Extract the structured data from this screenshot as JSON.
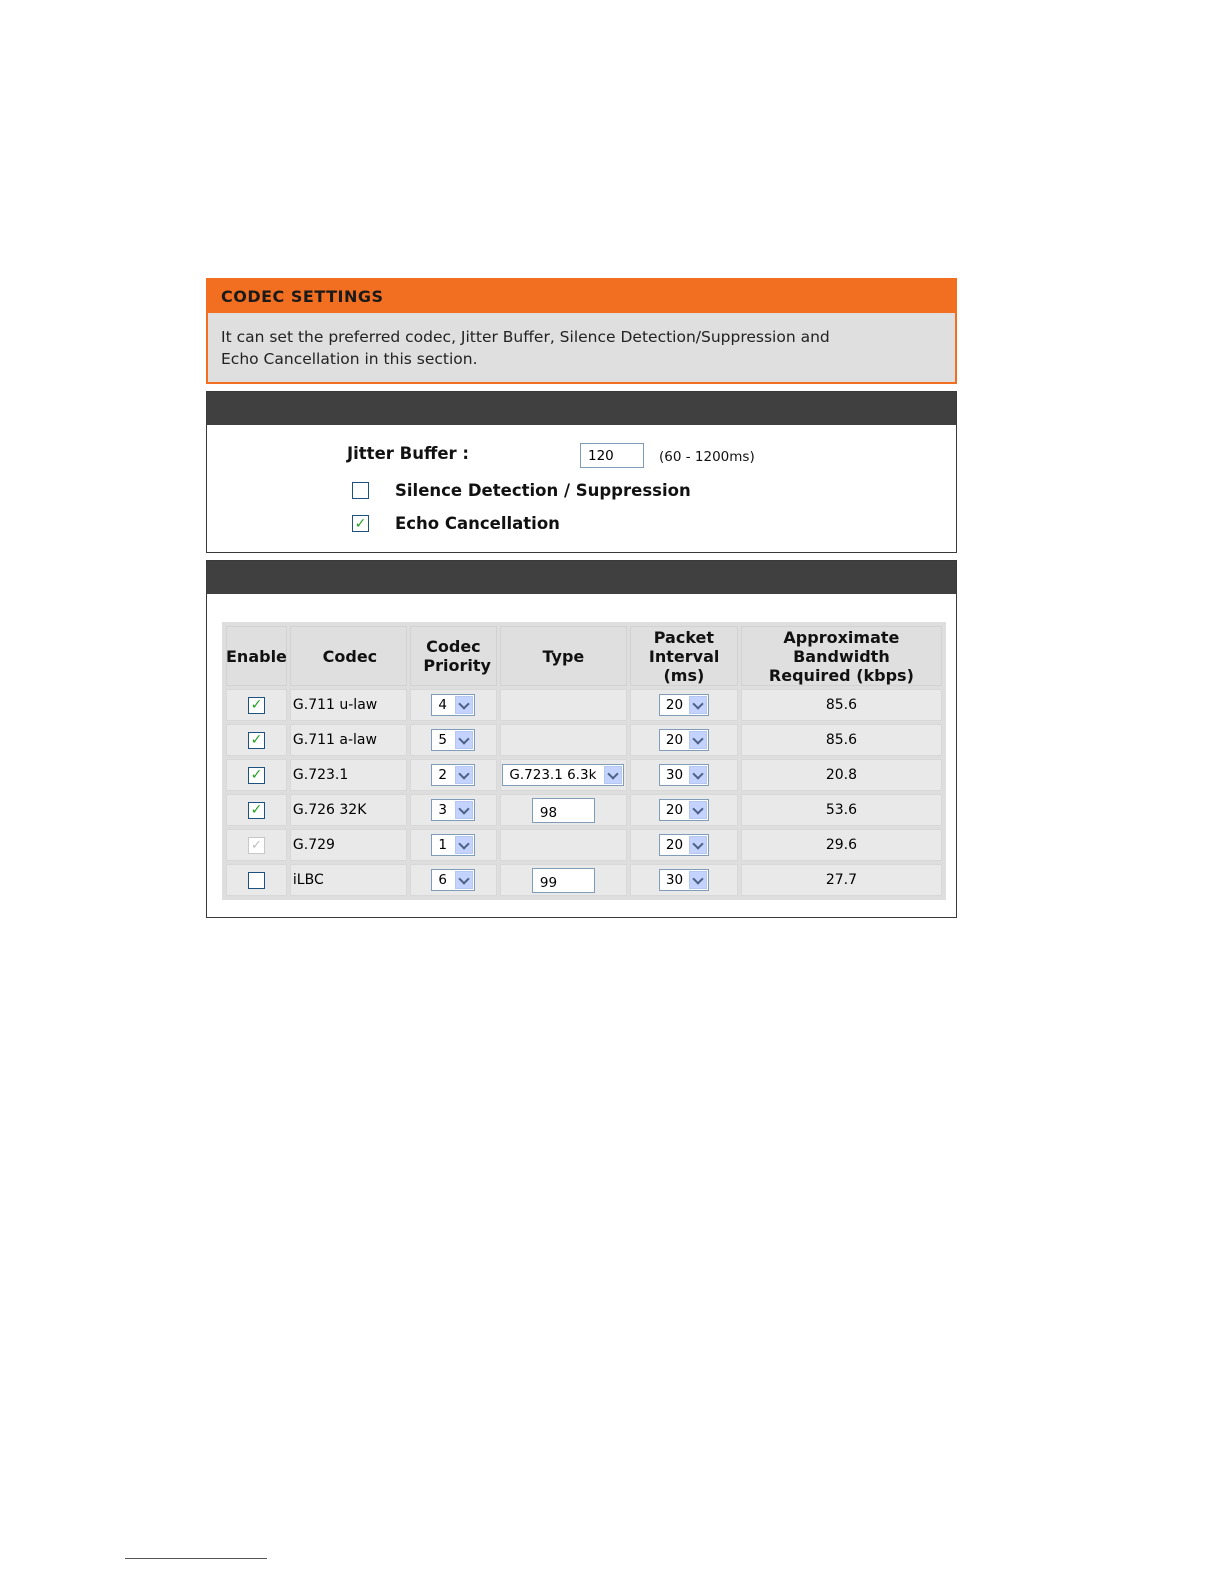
{
  "header": {
    "title": "CODEC SETTINGS",
    "description": "It can set the preferred codec, Jitter Buffer, Silence Detection/Suppression and Echo Cancellation in this section."
  },
  "voice_settings": {
    "jitter_label": "Jitter Buffer :",
    "jitter_value": "120",
    "jitter_range": "(60 - 1200ms)",
    "silence_label": "Silence Detection / Suppression",
    "silence_checked": false,
    "echo_label": "Echo Cancellation",
    "echo_checked": true
  },
  "codec_table": {
    "headers": {
      "enable": "Enable",
      "codec": "Codec",
      "priority": "Codec Priority",
      "type": "Type",
      "packet_interval": "Packet Interval (ms)",
      "bandwidth": "Approximate Bandwidth Required (kbps)"
    },
    "rows": [
      {
        "enabled": "checked",
        "codec": "G.711 u-law",
        "priority": "4",
        "type": "",
        "interval": "20",
        "bandwidth": "85.6"
      },
      {
        "enabled": "checked",
        "codec": "G.711 a-law",
        "priority": "5",
        "type": "",
        "interval": "20",
        "bandwidth": "85.6"
      },
      {
        "enabled": "checked",
        "codec": "G.723.1",
        "priority": "2",
        "type": "G.723.1 6.3k",
        "interval": "30",
        "bandwidth": "20.8"
      },
      {
        "enabled": "checked",
        "codec": "G.726 32K",
        "priority": "3",
        "type": "98",
        "interval": "20",
        "bandwidth": "53.6"
      },
      {
        "enabled": "disabled-checked",
        "codec": "G.729",
        "priority": "1",
        "type": "",
        "interval": "20",
        "bandwidth": "29.6"
      },
      {
        "enabled": "unchecked",
        "codec": "iLBC",
        "priority": "6",
        "type": "99",
        "interval": "30",
        "bandwidth": "27.7"
      }
    ]
  },
  "colors": {
    "accent": "#f26f21",
    "section_bar": "#404040",
    "check": "#21a121"
  }
}
